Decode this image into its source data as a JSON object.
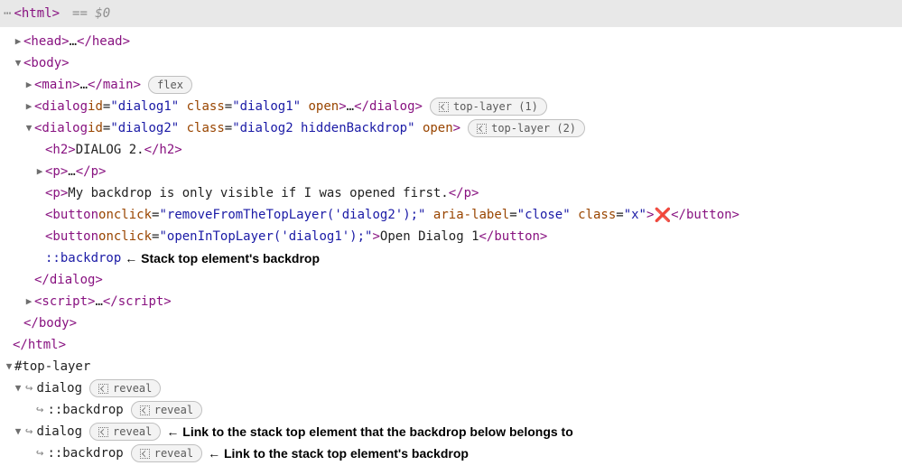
{
  "header": {
    "root_tag": "<html>",
    "eq": "== $0"
  },
  "badges": {
    "flex": "flex",
    "top1": "top-layer (1)",
    "top2": "top-layer (2)",
    "rev1": "reveal",
    "rev2": "reveal",
    "rev3": "reveal",
    "rev4": "reveal"
  },
  "tree": {
    "head": {
      "open": "<head>",
      "dots": "…",
      "close": "</head>"
    },
    "body": {
      "open": "<body>",
      "close": "</body>"
    },
    "main": {
      "open": "<main>",
      "dots": "…",
      "close": "</main>"
    },
    "d1": {
      "open_a": "<dialog ",
      "attr_id_n": "id",
      "attr_id_v": "\"dialog1\"",
      "attr_cls_n": "class",
      "attr_cls_v": "\"dialog1\"",
      "attr_open": "open",
      "open_b": ">",
      "dots": "…",
      "close": "</dialog>"
    },
    "d2": {
      "open_a": "<dialog ",
      "attr_id_n": "id",
      "attr_id_v": "\"dialog2\"",
      "attr_cls_n": "class",
      "attr_cls_v": "\"dialog2 hiddenBackdrop\"",
      "attr_open": "open",
      "open_b": ">",
      "close": "</dialog>"
    },
    "h2": {
      "open": "<h2>",
      "text": "DIALOG 2.",
      "close": "</h2>"
    },
    "p1": {
      "open": "<p>",
      "dots": "…",
      "close": "</p>"
    },
    "p2": {
      "open": "<p>",
      "text": "My backdrop is only visible if I was opened first.",
      "close": "</p>"
    },
    "btn1": {
      "open_a": "<button ",
      "onclick_n": "onclick",
      "onclick_v": "\"removeFromTheTopLayer('dialog2');\"",
      "aria_n": "aria-label",
      "aria_v": "\"close\"",
      "cls_n": "class",
      "cls_v": "\"x\"",
      "open_b": ">",
      "inner": "❌",
      "close": "</button>"
    },
    "btn2": {
      "open_a": "<button ",
      "onclick_n": "onclick",
      "onclick_v": "\"openInTopLayer('dialog1');\"",
      "open_b": ">",
      "inner": "Open Dialog 1",
      "close": "</button>"
    },
    "backdrop": "::backdrop",
    "script": {
      "open": "<script>",
      "dots": "…",
      "close": "</script>"
    },
    "html_close": "</html>"
  },
  "toplayer": {
    "title": "#top-layer",
    "item1": "dialog",
    "item1b": "::backdrop",
    "item2": "dialog",
    "item2b": "::backdrop"
  },
  "annotations": {
    "a1": "← Stack top element's backdrop",
    "a2": "← Link to the stack top element that the backdrop below belongs to",
    "a3": "← Link to the stack top element's backdrop"
  }
}
